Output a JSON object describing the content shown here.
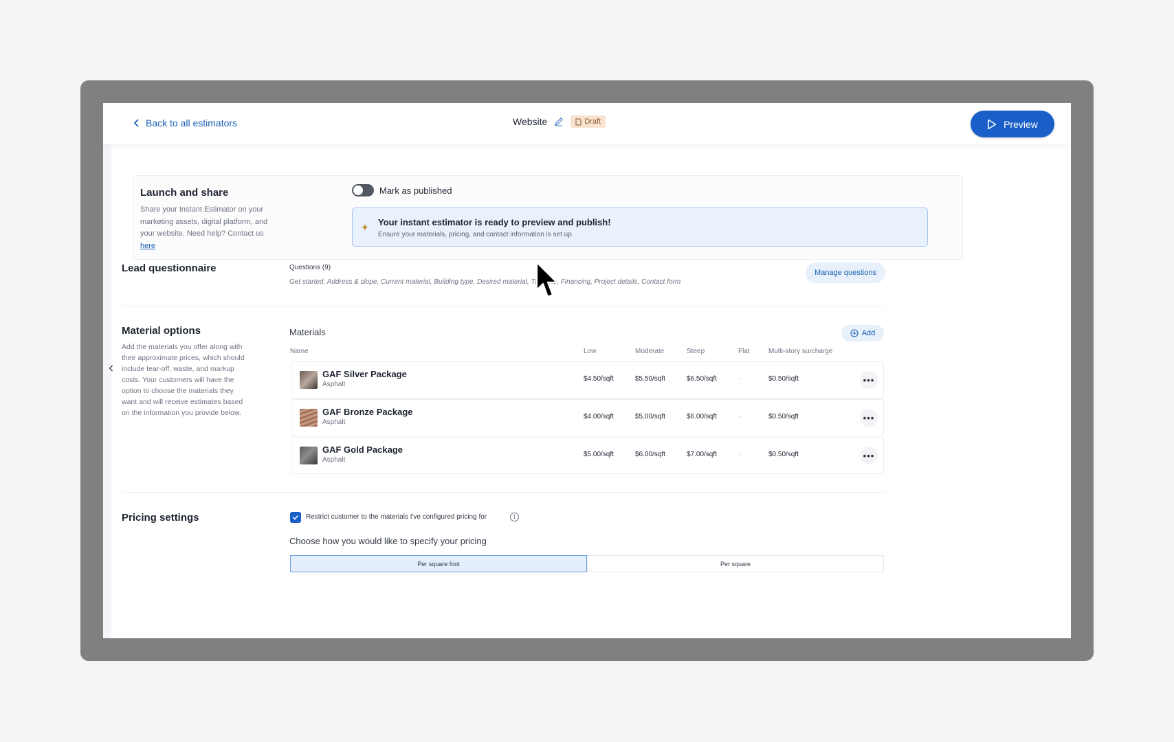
{
  "header": {
    "back_label": "Back to all estimators",
    "title": "Website",
    "status_badge": "Draft",
    "preview_label": "Preview"
  },
  "launch": {
    "title": "Launch and share",
    "description": "Share your Instant Estimator on your marketing assets, digital platform, and your website. Need help? Contact us",
    "link_text": "here",
    "toggle_label": "Mark as published",
    "toggle_on": false,
    "notice_title": "Your instant estimator is ready to preview and publish!",
    "notice_subtitle": "Ensure your materials, pricing, and contact information is set up"
  },
  "questionnaire": {
    "title": "Lead questionnaire",
    "questions_label": "Questions (9)",
    "questions_list": "Get started, Address & slope, Current material, Building type, Desired material, Timeline, Financing, Project details, Contact form",
    "manage_label": "Manage questions"
  },
  "materials": {
    "title": "Material options",
    "description": "Add the materials you offer along with their approximate prices, which should include tear-off, waste, and markup costs. Your customers will have the option to choose the materials they want and will receive estimates based on the information you provide below.",
    "table_title": "Materials",
    "add_label": "Add",
    "columns": [
      "Name",
      "Low",
      "Moderate",
      "Steep",
      "Flat",
      "Multi-story surcharge"
    ],
    "rows": [
      {
        "name": "GAF Silver Package",
        "type": "Asphalt",
        "low": "$4.50/sqft",
        "moderate": "$5.50/sqft",
        "steep": "$6.50/sqft",
        "flat": "-",
        "surcharge": "$0.50/sqft"
      },
      {
        "name": "GAF Bronze Package",
        "type": "Asphalt",
        "low": "$4.00/sqft",
        "moderate": "$5.00/sqft",
        "steep": "$6.00/sqft",
        "flat": "-",
        "surcharge": "$0.50/sqft"
      },
      {
        "name": "GAF Gold Package",
        "type": "Asphalt",
        "low": "$5.00/sqft",
        "moderate": "$6.00/sqft",
        "steep": "$7.00/sqft",
        "flat": "-",
        "surcharge": "$0.50/sqft"
      }
    ],
    "more_label": "•••"
  },
  "pricing": {
    "title": "Pricing settings",
    "restrict_label": "Restrict customer to the materials I've configured pricing for",
    "restrict_checked": true,
    "choose_label": "Choose how you would like to specify your pricing",
    "options": [
      "Per square foot",
      "Per square"
    ],
    "selected": "Per square foot"
  },
  "colors": {
    "accent": "#1a5fc8",
    "link": "#1a5fb4",
    "draft_bg": "#f8e3cf",
    "notice_bg": "#e9f1fc"
  }
}
